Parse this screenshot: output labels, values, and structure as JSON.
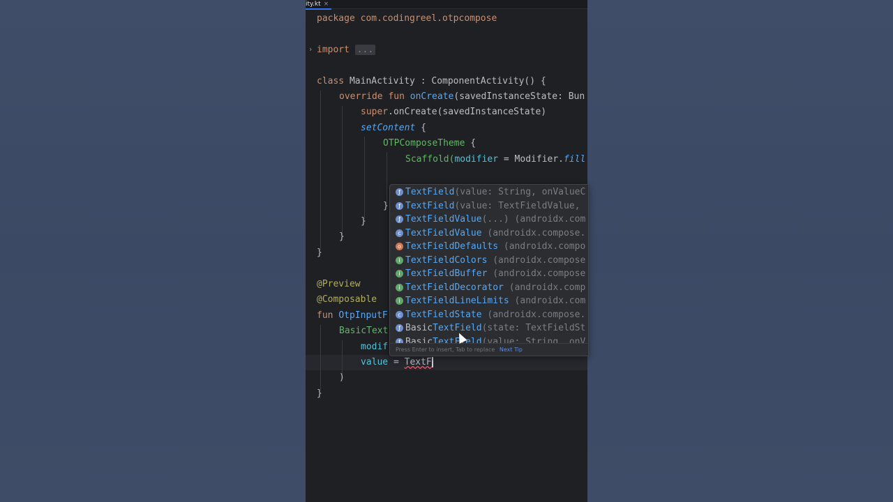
{
  "tab": {
    "label": "ity.kt",
    "close": "×"
  },
  "code": {
    "l1": "package com.codingreel.otpcompose",
    "l2_kw": "import",
    "l2_fold": "...",
    "l3_kw": "class",
    "l3_rest": " MainActivity : ComponentActivity() {",
    "l4_kw": "override fun",
    "l4_fn": "onCreate",
    "l4_rest": "(savedInstanceState: Bun",
    "l5_kw": "super",
    "l5_rest": ".onCreate(savedInstanceState)",
    "l6_fn": "setContent",
    "l6_rest": " {",
    "l7_comp": "OTPComposeTheme",
    "l7_rest": " {",
    "l8_a": "Scaffold(",
    "l8_par": "modifier",
    "l8_b": " = Modifier.",
    "l8_it": "fill",
    "l9": "}",
    "l10": "}",
    "l11": "}",
    "l12": "}",
    "l13": "@Preview",
    "l14": "@Composable",
    "l15_kw": "fun",
    "l15_fn": "OtpInputF",
    "l16": "BasicText",
    "l17_par": "modif",
    "l18_par": "value",
    "l18_eq": " = ",
    "l18_typed": "TextF",
    "l19": ")",
    "l20": "}"
  },
  "completion": {
    "items": [
      {
        "icon": "function-icon",
        "match": "TextField",
        "rest": "(value: String, onValueC"
      },
      {
        "icon": "function-icon",
        "match": "TextField",
        "rest": "(value: TextFieldValue,"
      },
      {
        "icon": "function-icon",
        "match": "TextFieldValue",
        "rest": "(...) (androidx.com"
      },
      {
        "icon": "class-icon",
        "match": "TextFieldValue",
        "rest": " (androidx.compose."
      },
      {
        "icon": "object-icon",
        "match": "TextFieldDefaults",
        "rest": " (androidx.compo"
      },
      {
        "icon": "interface-icon",
        "match": "TextFieldColors",
        "rest": " (androidx.compose"
      },
      {
        "icon": "interface-icon",
        "match": "TextFieldBuffer",
        "rest": " (androidx.compose"
      },
      {
        "icon": "interface-icon",
        "match": "TextFieldDecorator",
        "rest": " (androidx.comp"
      },
      {
        "icon": "interface-icon",
        "match": "TextFieldLineLimits",
        "rest": " (androidx.com"
      },
      {
        "icon": "class-icon",
        "match": "TextFieldState",
        "rest": " (androidx.compose."
      },
      {
        "icon": "function-icon",
        "prefix": "Basic",
        "match": "TextField",
        "rest": "(state: TextFieldSt"
      },
      {
        "icon": "function-icon",
        "prefix": "Basic",
        "match": "TextField",
        "rest": "(value: String, onV"
      }
    ],
    "footer": "Press Enter to insert, Tab to replace",
    "footer_link": "Next Tip"
  }
}
